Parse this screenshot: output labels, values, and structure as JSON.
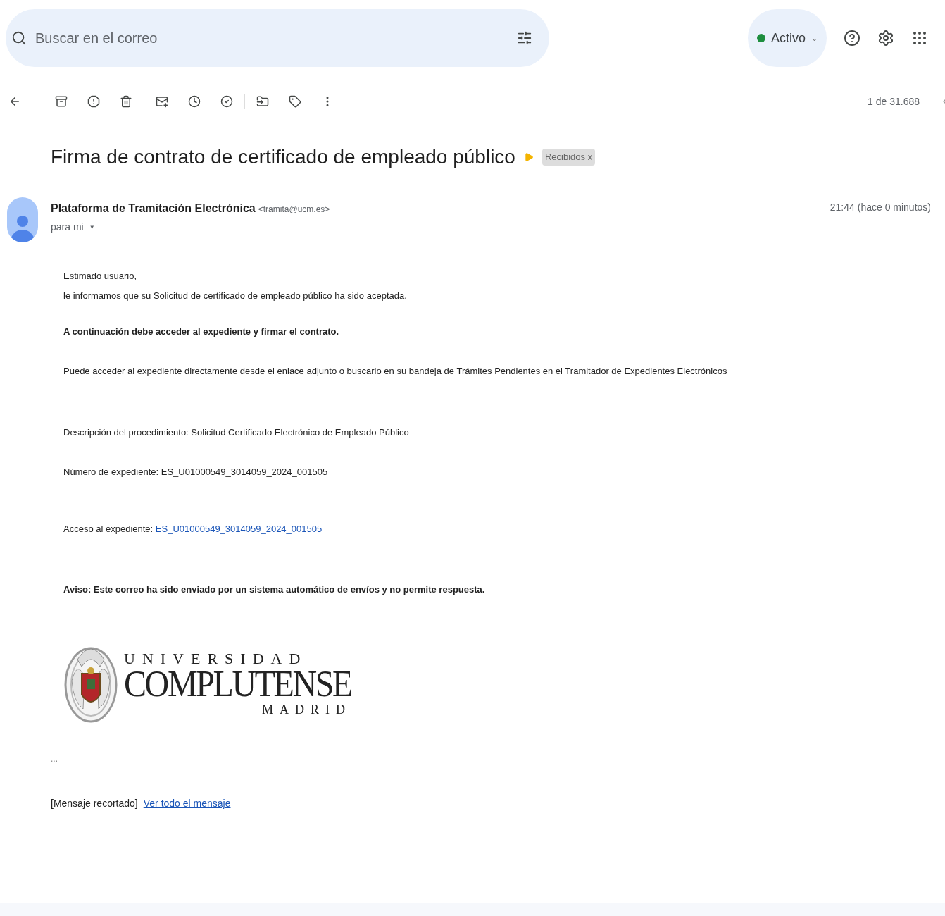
{
  "search": {
    "placeholder": "Buscar en el correo"
  },
  "status": {
    "label": "Activo",
    "caret": "⌄"
  },
  "pagination": {
    "text": "1 de 31.688"
  },
  "message": {
    "subject": "Firma de contrato de certificado de empleado público",
    "labels": [
      {
        "text": "Recibidos",
        "remove": "x"
      }
    ],
    "sender": {
      "name": "Plataforma de Tramitación Electrónica",
      "email": "<tramita@ucm.es>"
    },
    "recipient": "para mi",
    "recipient_caret": "▼",
    "time": "21:44 (hace 0 minutos)",
    "body": [
      {
        "kind": "text",
        "text": "Estimado usuario,"
      },
      {
        "kind": "text",
        "text": "le informamos que su Solicitud de certificado de empleado público ha sido aceptada."
      },
      {
        "kind": "bold",
        "text": "A continuación debe acceder al expediente y firmar el contrato."
      },
      {
        "kind": "text",
        "text": "Puede acceder al expediente directamente desde el enlace adjunto o buscarlo en su bandeja de Trámites Pendientes en el Tramitador de Expedientes Electrónicos"
      },
      {
        "kind": "text",
        "text": "Descripción del procedimiento: Solicitud Certificado Electrónico de Empleado Público"
      },
      {
        "kind": "text",
        "text": "Número de expediente: ES_U01000549_3014059_2024_001505"
      },
      {
        "kind": "link",
        "text": "Acceso al expediente: ",
        "link": "ES_U01000549_3014059_2024_001505"
      },
      {
        "kind": "bold",
        "text": "Aviso: Este correo ha sido enviado por un sistema automático de envíos y no permite respuesta."
      }
    ],
    "logo": {
      "line_1": "UNIVERSIDAD",
      "line_2": "COMPLUTENSE",
      "line_3": "MADRID"
    },
    "ellipsis": "...",
    "trimmed": {
      "text": "[Mensaje recortado]",
      "link": "Ver todo el mensaje"
    }
  }
}
